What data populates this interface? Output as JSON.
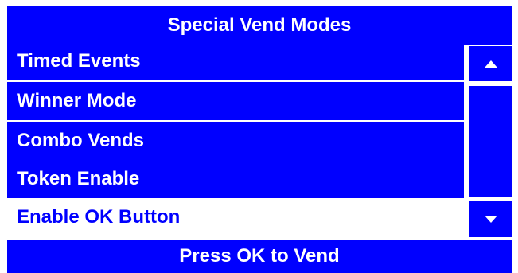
{
  "header": {
    "title": "Special Vend Modes"
  },
  "menu": {
    "items": [
      {
        "label": "Timed Events",
        "selected": false
      },
      {
        "label": "Winner Mode",
        "selected": false
      },
      {
        "label": "Combo Vends",
        "selected": false
      },
      {
        "label": "Token Enable",
        "selected": false
      },
      {
        "label": "Enable OK Button",
        "selected": true
      }
    ]
  },
  "scrollbar": {
    "up_icon": "triangle-up-icon",
    "down_icon": "triangle-down-icon"
  },
  "footer": {
    "prompt": "Press OK to Vend"
  },
  "colors": {
    "accent": "#0000ff",
    "background": "#ffffff",
    "text_on_accent": "#ffffff",
    "selected_text": "#0000ff"
  }
}
